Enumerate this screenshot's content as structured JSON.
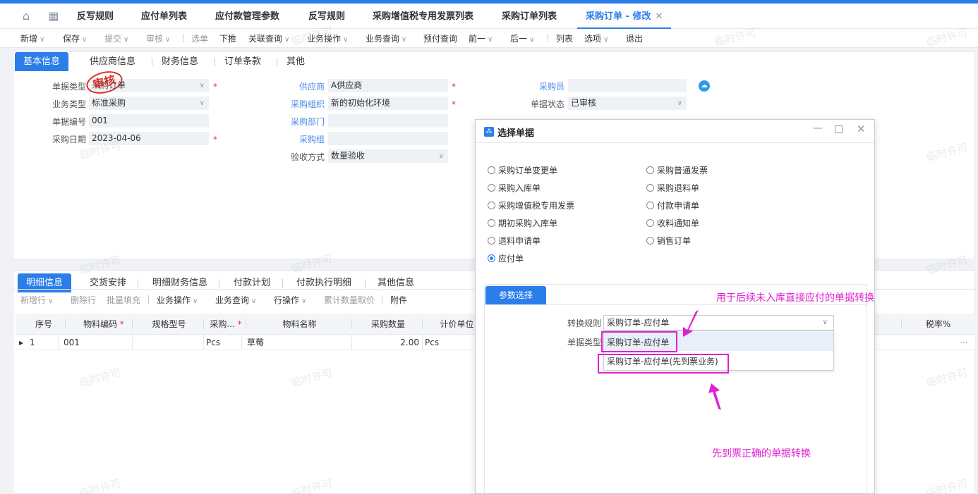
{
  "tabs": [
    "反写规则",
    "应付单列表",
    "应付款管理参数",
    "反写规则",
    "采购增值税专用发票列表",
    "采购订单列表",
    "采购订单 - 修改"
  ],
  "toolbar": {
    "items": [
      "新增",
      "保存",
      "提交",
      "审核",
      "选单",
      "下推",
      "关联查询",
      "业务操作",
      "业务查询",
      "预付查询",
      "前一",
      "后一",
      "列表",
      "选项",
      "退出"
    ]
  },
  "header_tabs": [
    "基本信息",
    "供应商信息",
    "财务信息",
    "订单条款",
    "其他"
  ],
  "form": {
    "bill_type_label": "单据类型",
    "bill_type_value": "采购订单",
    "biz_type_label": "业务类型",
    "biz_type_value": "标准采购",
    "bill_no_label": "单据编号",
    "bill_no_value": "001",
    "date_label": "采购日期",
    "date_value": "2023-04-06",
    "supplier_label": "供应商",
    "supplier_value": "A供应商",
    "org_label": "采购组织",
    "org_value": "新的初始化环境",
    "dept_label": "采购部门",
    "group_label": "采购组",
    "inspect_label": "验收方式",
    "inspect_value": "数量验收",
    "buyer_label": "采购员",
    "status_label": "单据状态",
    "status_value": "已审核",
    "stamp_text": "审核"
  },
  "detail_tabs": [
    "明细信息",
    "交货安排",
    "明细财务信息",
    "付款计划",
    "付款执行明细",
    "其他信息"
  ],
  "detail_toolbar": [
    "新增行",
    "删除行",
    "批量填充",
    "业务操作",
    "业务查询",
    "行操作",
    "累计数量取价",
    "附件"
  ],
  "grid": {
    "columns": [
      "序号",
      "物料编码",
      "规格型号",
      "采购...",
      "物料名称",
      "采购数量",
      "计价单位",
      "税率%"
    ],
    "row": {
      "seq": "1",
      "code": "001",
      "unit": "Pcs",
      "name": "草莓",
      "qty": "2.00",
      "price_unit": "Pcs"
    }
  },
  "dialog": {
    "title": "选择单据",
    "options_left": [
      "采购订单变更单",
      "采购入库单",
      "采购增值税专用发票",
      "期初采购入库单",
      "退料申请单",
      "应付单"
    ],
    "options_right": [
      "采购普通发票",
      "采购退料单",
      "付款申请单",
      "收料通知单",
      "销售订单"
    ],
    "param_tab": "参数选择",
    "rule_label": "转换规则",
    "rule_value": "采购订单-应付单",
    "bill_type_label": "单据类型",
    "dropdown_options": [
      "采购订单-应付单",
      "采购订单-应付单(先到票业务)"
    ]
  },
  "annotations": {
    "top": "用于后续未入库直接应付的单据转换",
    "bottom": "先到票正确的单据转换"
  },
  "watermark": "临时许可",
  "colors": {
    "accent": "#2b7de9",
    "annotation": "#e01fd0",
    "required": "#e53935"
  }
}
